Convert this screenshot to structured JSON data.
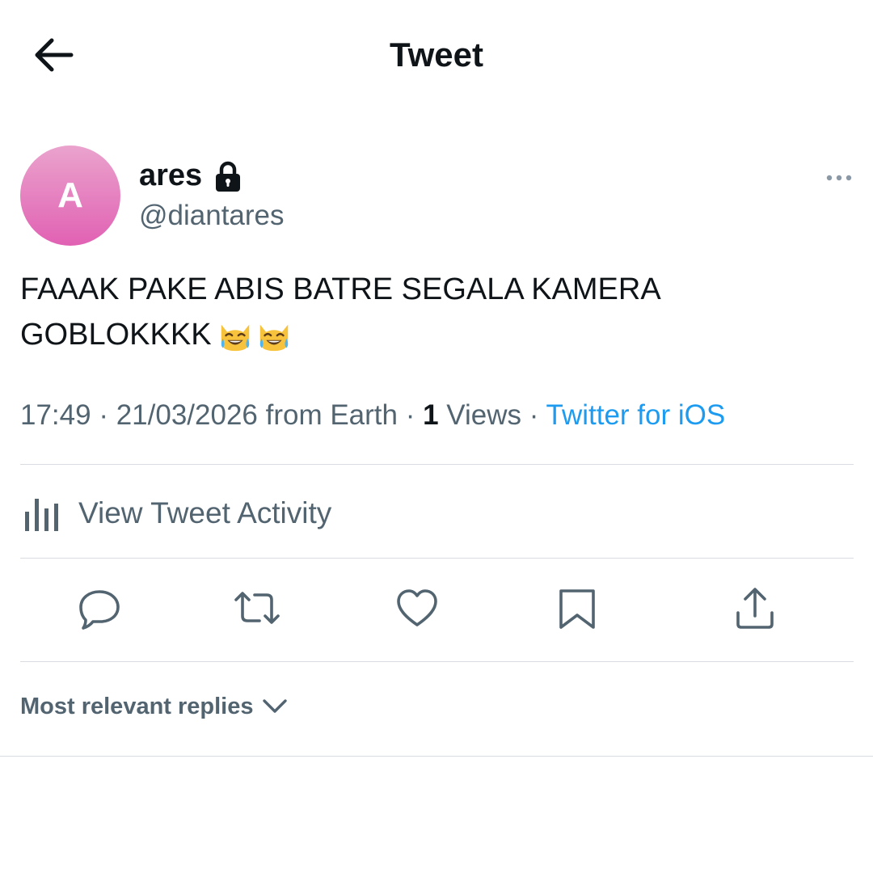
{
  "header": {
    "title": "Tweet",
    "back_icon": "arrow-left-icon"
  },
  "author": {
    "avatar_initial": "A",
    "avatar_colors": [
      "#eaa3cd",
      "#e161b3"
    ],
    "display_name": "ares",
    "protected_icon": "lock-icon",
    "handle": "@diantares",
    "more_icon": "more-horizontal-icon"
  },
  "tweet": {
    "line1": "FAAAK PAKE ABIS BATRE SEGALA KAMERA",
    "line2": "GOBLOKKKK",
    "emoji": [
      "cat-with-tears-of-joy",
      "cat-with-tears-of-joy"
    ]
  },
  "meta": {
    "time": "17:49",
    "sep1": " · ",
    "date": "21/03/2026",
    "from": " from Earth · ",
    "views_count": "1",
    "views_label": " Views",
    "sep2": " · ",
    "source": "Twitter for iOS",
    "link_color": "#1d9bf0"
  },
  "activity": {
    "icon": "bar-chart-icon",
    "label": "View Tweet Activity"
  },
  "actions": [
    {
      "name": "reply",
      "icon": "reply-icon"
    },
    {
      "name": "retweet",
      "icon": "retweet-icon"
    },
    {
      "name": "like",
      "icon": "heart-icon"
    },
    {
      "name": "bookmark",
      "icon": "bookmark-icon"
    },
    {
      "name": "share",
      "icon": "share-icon"
    }
  ],
  "replies": {
    "sort_label": "Most relevant replies",
    "chevron_icon": "chevron-down-icon"
  },
  "colors": {
    "text": "#0f1419",
    "secondary": "#536471",
    "divider": "#d9dde1",
    "accent": "#1d9bf0"
  }
}
